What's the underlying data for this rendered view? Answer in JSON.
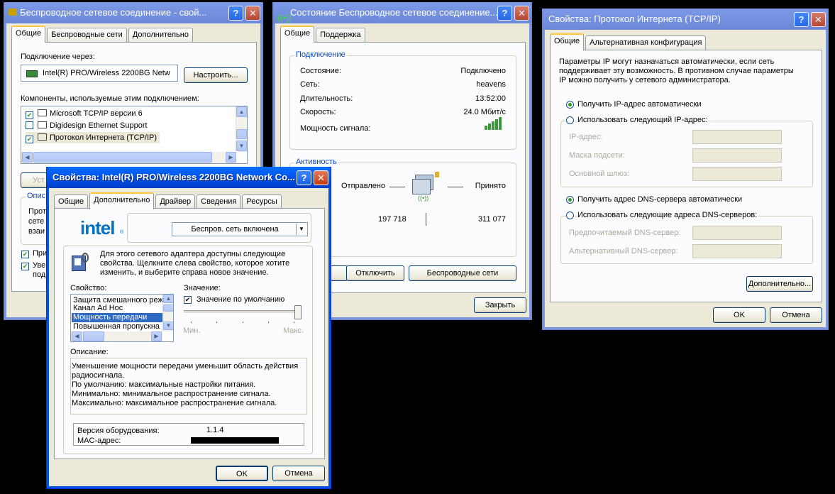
{
  "win1": {
    "title": "Беспроводное сетевое соединение - свой...",
    "tabs": [
      "Общие",
      "Беспроводные сети",
      "Дополнительно"
    ],
    "connect_via_label": "Подключение через:",
    "adapter": "Intel(R) PRO/Wireless 2200BG Netw",
    "configure_button": "Настроить...",
    "components_label": "Компоненты, используемые этим подключением:",
    "components": [
      {
        "name": "Microsoft TCP/IP версии 6",
        "checked": true
      },
      {
        "name": "Digidesign Ethernet Support",
        "checked": false
      },
      {
        "name": "Протокол Интернета (TCP/IP)",
        "checked": true
      }
    ],
    "install_button_partial": "Уст",
    "description_group_partial": "Опис",
    "description_text_partial": [
      "Прот",
      "сете",
      "взаи"
    ],
    "checkbox1_partial": "При",
    "checkbox2_partial": [
      "Уве",
      "подк"
    ]
  },
  "win2": {
    "title": "Состояние Беспроводное сетевое соединение...",
    "tabs": [
      "Общие",
      "Поддержка"
    ],
    "connection_group": "Подключение",
    "rows": [
      {
        "label": "Состояние:",
        "value": "Подключено"
      },
      {
        "label": "Сеть:",
        "value": "heavens"
      },
      {
        "label": "Длительность:",
        "value": "13:52:00"
      },
      {
        "label": "Скорость:",
        "value": "24.0 Мбит/с"
      }
    ],
    "signal_label": "Мощность сигнала:",
    "activity_group": "Активность",
    "sent_label": "Отправлено",
    "received_label": "Принято",
    "sent_value": "197 718",
    "received_value": "311 077",
    "disconnect_button": "Отключить",
    "wireless_button": "Беспроводные сети",
    "close_button": "Закрыть"
  },
  "win3": {
    "title": "Свойства: Протокол Интернета (TCP/IP)",
    "tabs": [
      "Общие",
      "Альтернативная конфигурация"
    ],
    "intro": [
      "Параметры IP могут назначаться автоматически, если сеть",
      "поддерживает эту возможность. В противном случае параметры",
      "IP можно получить у сетевого администратора."
    ],
    "ip_auto": "Получить IP-адрес автоматически",
    "ip_manual": "Использовать следующий IP-адрес:",
    "ip_label": "IP-адрес:",
    "mask_label": "Маска подсети:",
    "gateway_label": "Основной шлюз:",
    "dns_auto": "Получить адрес DNS-сервера автоматически",
    "dns_manual": "Использовать следующие адреса DNS-серверов:",
    "dns_pref_label": "Предпочитаемый DNS-сервер:",
    "dns_alt_label": "Альтернативный DNS-сервер:",
    "advanced_button": "Дополнительно...",
    "ok_button": "OK",
    "cancel_button": "Отмена"
  },
  "win4": {
    "title": "Свойства: Intel(R) PRO/Wireless 2200BG Network Co...",
    "tabs": [
      "Общие",
      "Дополнительно",
      "Драйвер",
      "Сведения",
      "Ресурсы"
    ],
    "logo": "intel",
    "radio_state": "Беспров. сеть включена",
    "info": [
      "Для этого сетевого адаптера доступны следующие",
      "свойства. Щелкните слева свойство, которое хотите",
      "изменить, и выберите справа новое значение."
    ],
    "property_label": "Свойство:",
    "properties": [
      "Защита смешанного реж",
      "Канал Ad Hoc",
      "Мощность передачи",
      "Повышенная пропускна"
    ],
    "value_label": "Значение:",
    "default_value": "Значение по умолчанию",
    "min_label": "Мин.",
    "max_label": "Макс.",
    "description_label": "Описание:",
    "description": [
      "Уменьшение мощности передачи уменьшит область действия",
      "радиосигнала.",
      "По умолчанию: максимальные настройки питания.",
      "Минимально: минимальное распространение сигнала.",
      "Максимально: максимальное распространение сигнала."
    ],
    "hw_version_label": "Версия оборудования:",
    "hw_version": "1.1.4",
    "mac_label": "MAC-адрес:",
    "ok_button": "OK",
    "cancel_button": "Отмена"
  }
}
